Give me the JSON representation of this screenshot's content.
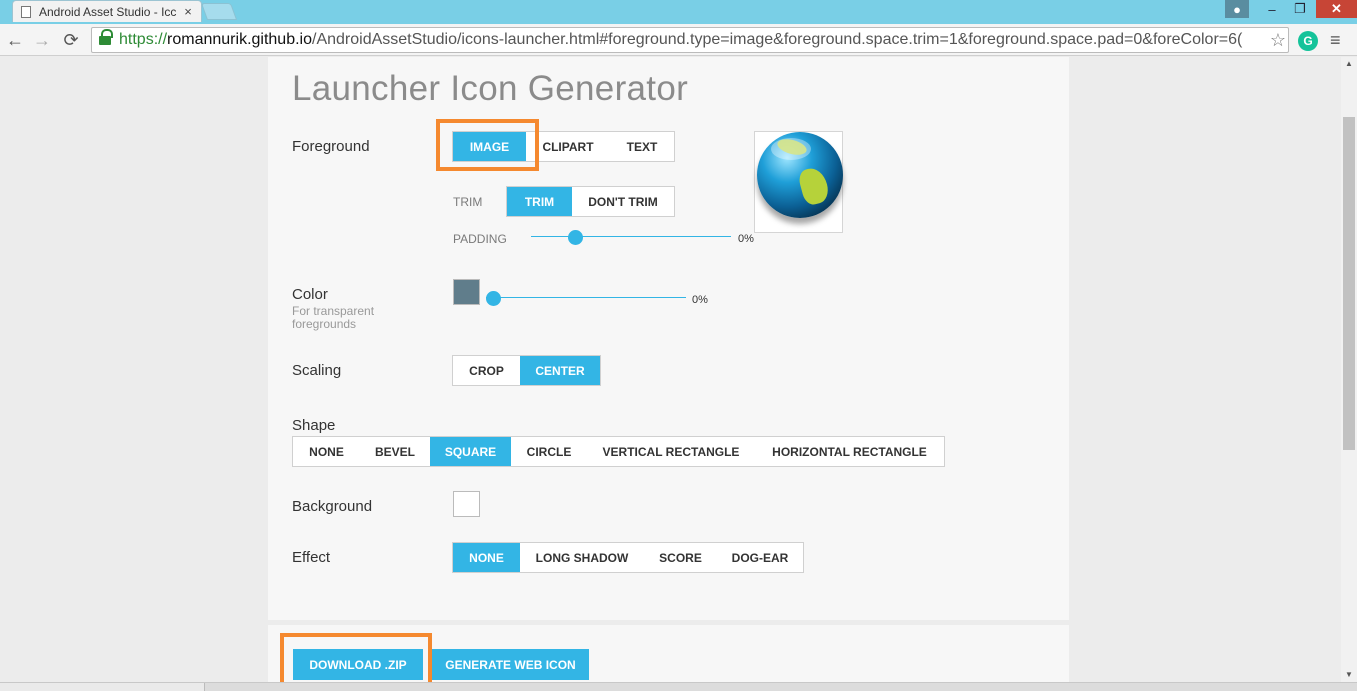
{
  "browser": {
    "tab_title": "Android Asset Studio - Icc",
    "tab_close": "×",
    "url_scheme": "https://",
    "url_host": "romannurik.github.io",
    "url_path": "/AndroidAssetStudio/icons-launcher.html#foreground.type=image&foreground.space.trim=1&foreground.space.pad=0&foreColor=6(",
    "star_icon": "☆",
    "extension_letter": "G",
    "menu_icon": "≡",
    "window_min": "–",
    "window_max": "❐",
    "window_close": "✕",
    "user_icon": "👤",
    "back_icon": "←",
    "forward_icon": "→",
    "reload_icon": "⟳"
  },
  "page": {
    "title": "Launcher Icon Generator",
    "foreground": {
      "label": "Foreground",
      "options": [
        "IMAGE",
        "CLIPART",
        "TEXT"
      ],
      "selected": "IMAGE",
      "trim_label": "TRIM",
      "trim_options": [
        "TRIM",
        "DON'T TRIM"
      ],
      "trim_selected": "TRIM",
      "padding_label": "PADDING",
      "padding_value": "0%",
      "padding_fraction": 0.2
    },
    "color": {
      "label": "Color",
      "hint": "For transparent foregrounds",
      "swatch": "#607d8b",
      "value": "0%",
      "fraction": 0.0
    },
    "scaling": {
      "label": "Scaling",
      "options": [
        "CROP",
        "CENTER"
      ],
      "selected": "CENTER"
    },
    "shape": {
      "label": "Shape",
      "options": [
        "NONE",
        "BEVEL",
        "SQUARE",
        "CIRCLE",
        "VERTICAL RECTANGLE",
        "HORIZONTAL RECTANGLE"
      ],
      "selected": "SQUARE"
    },
    "background": {
      "label": "Background",
      "swatch": "#ffffff"
    },
    "effect": {
      "label": "Effect",
      "options": [
        "NONE",
        "LONG SHADOW",
        "SCORE",
        "DOG-EAR"
      ],
      "selected": "NONE"
    },
    "actions": {
      "download": "DOWNLOAD .ZIP",
      "web_icon": "GENERATE WEB ICON"
    }
  },
  "colors": {
    "accent": "#33b5e5",
    "highlight": "#f5892f"
  }
}
